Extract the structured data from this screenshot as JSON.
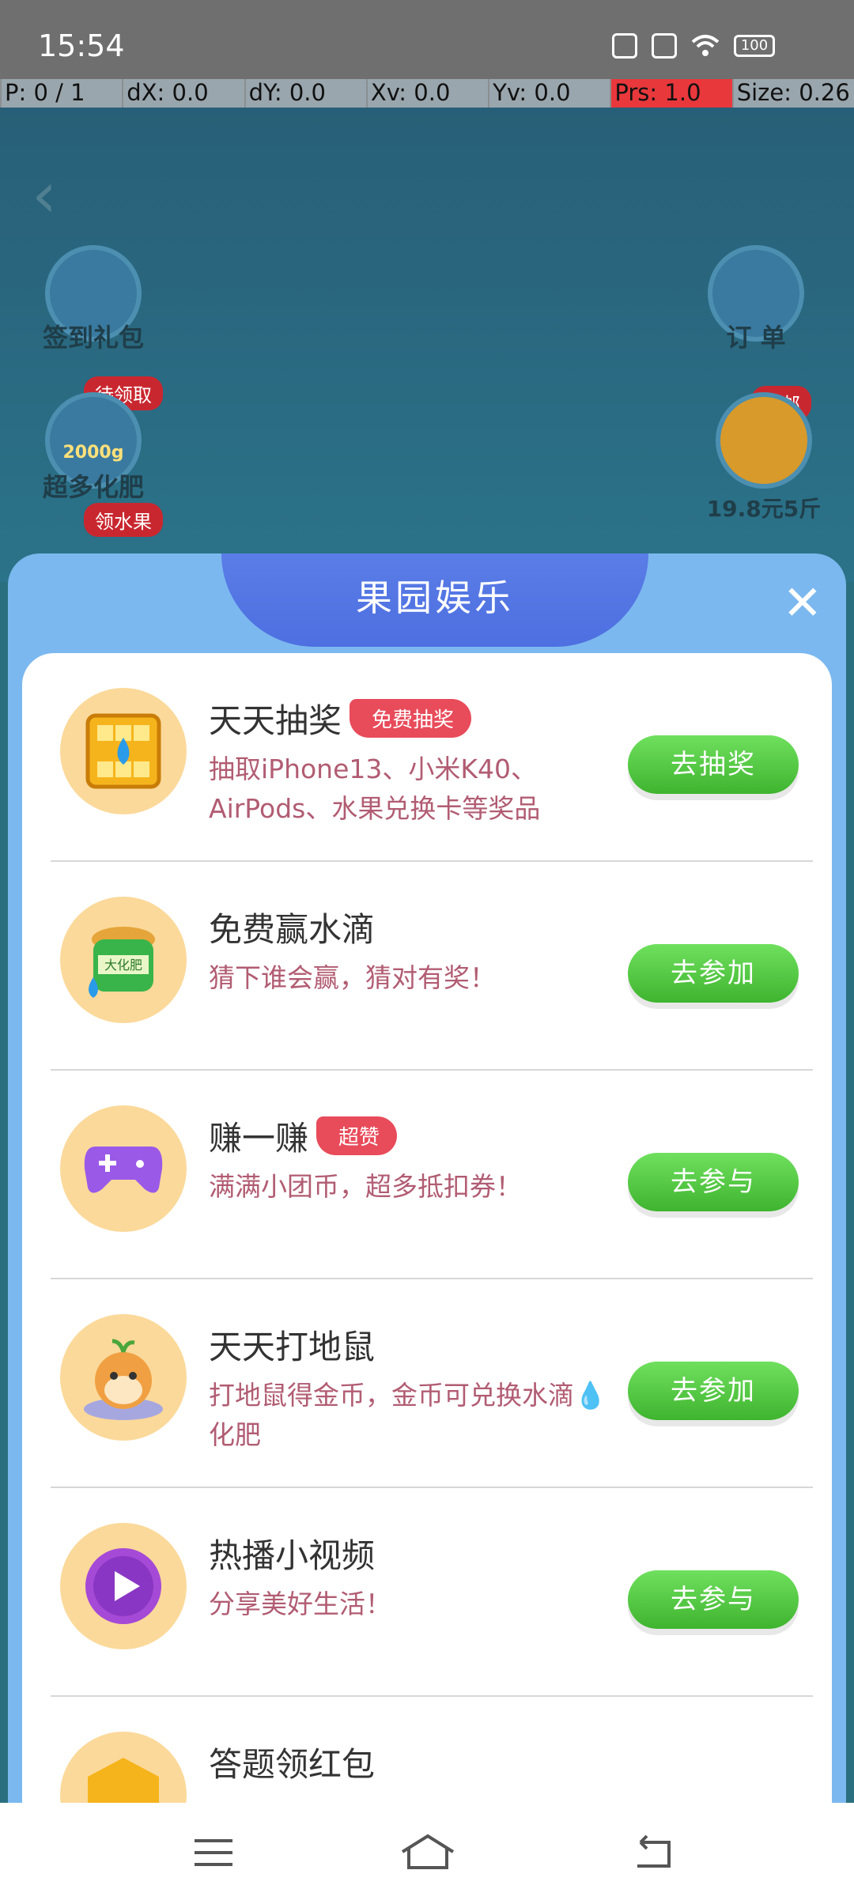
{
  "status_bar": {
    "time": "15:54",
    "battery": "100"
  },
  "debug": {
    "p": "P: 0 / 1",
    "dx": "dX: 0.0",
    "dy": "dY: 0.0",
    "xv": "Xv: 0.0",
    "yv": "Yv: 0.0",
    "prs": "Prs: 1.0",
    "size": "Size: 0.26"
  },
  "background": {
    "left_items": [
      {
        "label": "签到礼包",
        "tag": ""
      },
      {
        "label": "超多化肥",
        "tag": "待领取",
        "sub": "2000g"
      },
      {
        "label": "",
        "tag": "领水果"
      }
    ],
    "right_items": [
      {
        "label": "订 单",
        "tag": ""
      },
      {
        "label": "19.8元5斤",
        "tag": "包邮"
      }
    ]
  },
  "modal": {
    "title": "果园娱乐",
    "items": [
      {
        "title": "天天抽奖",
        "badge": "免费抽奖",
        "desc": "抽取iPhone13、小米K40、AirPods、水果兑换卡等奖品",
        "button": "去抽奖",
        "icon": "lottery-icon"
      },
      {
        "title": "免费赢水滴",
        "badge": "",
        "desc": "猜下谁会赢，猜对有奖！",
        "button": "去参加",
        "icon": "fertilizer-bag-icon"
      },
      {
        "title": "赚一赚",
        "badge": "超赞",
        "desc": "满满小团币，超多抵扣券！",
        "button": "去参与",
        "icon": "gamepad-icon"
      },
      {
        "title": "天天打地鼠",
        "badge": "",
        "desc": "打地鼠得金币，金币可兑换水滴💧化肥",
        "button": "去参加",
        "icon": "hamster-icon"
      },
      {
        "title": "热播小视频",
        "badge": "",
        "desc": "分享美好生活！",
        "button": "去参与",
        "icon": "play-icon"
      },
      {
        "title": "答题领红包",
        "badge": "",
        "desc": "",
        "button": "",
        "icon": "quiz-icon"
      }
    ]
  },
  "colors": {
    "button_green": "#4cc63b",
    "badge_red": "#e84b5a",
    "modal_blue": "#7bb8ef"
  }
}
